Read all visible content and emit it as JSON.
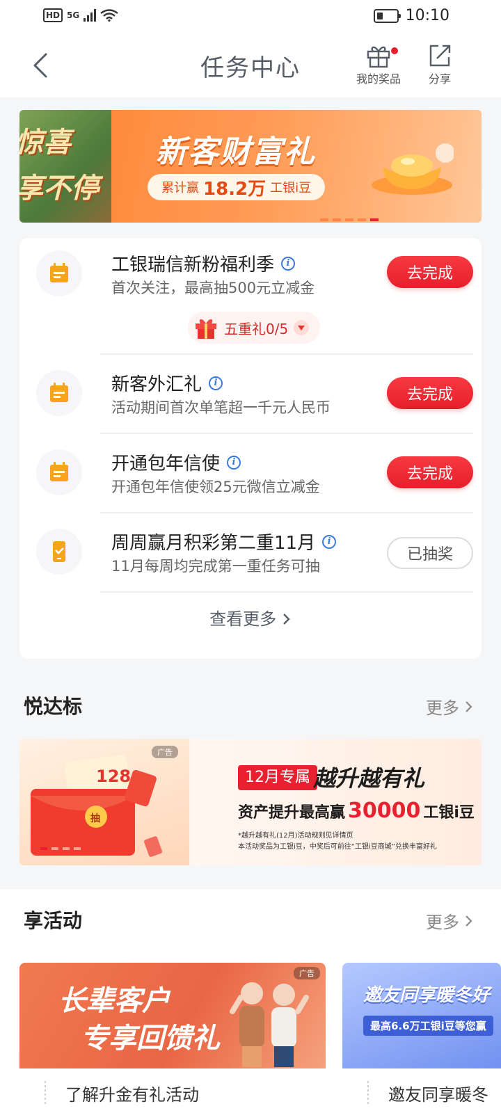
{
  "status_bar": {
    "network_hd": "HD",
    "network_gen": "5G",
    "time": "10:10"
  },
  "header": {
    "title": "任务中心",
    "my_prizes_label": "我的奖品",
    "share_label": "分享"
  },
  "banner": {
    "side_text_line1": "惊喜",
    "side_text_line2": "享不停",
    "title": "新客财富礼",
    "pill_prefix": "累计赢",
    "pill_amount": "18.2万",
    "pill_suffix": "工银i豆"
  },
  "tasks": [
    {
      "title": "工银瑞信新粉福利季",
      "subtitle": "首次关注，最高抽500元立减金",
      "button": "去完成",
      "icon": "calendar-icon"
    },
    {
      "title": "新客外汇礼",
      "subtitle": "活动期间首次单笔超一千元人民币",
      "button": "去完成",
      "icon": "calendar-icon"
    },
    {
      "title": "开通包年信使",
      "subtitle": "开通包年信使领25元微信立减金",
      "button": "去完成",
      "icon": "calendar-icon"
    },
    {
      "title": "周周赢月积彩第二重11月",
      "subtitle": "11月每周均完成第一重任务可抽",
      "button": "已抽奖",
      "icon": "phone-check-icon"
    }
  ],
  "five_gift": {
    "label": "五重礼0/5"
  },
  "view_more": "查看更多",
  "section_yuedabiao": {
    "title": "悦达标",
    "more": "更多"
  },
  "ad": {
    "tag": "广告",
    "left_amount": "128",
    "left_draw": "抽",
    "badge": "12月专属",
    "headline": "越升越有礼",
    "line2_prefix": "资产提升最高赢",
    "line2_amount": "30000",
    "line2_suffix": "工银i豆",
    "note1": "*越升越有礼(12月)活动规则见详情页",
    "note2": "本活动奖品为工银i豆，中奖后可前往“工银i豆商城”兑换丰富好礼"
  },
  "section_activities": {
    "title": "享活动",
    "more": "更多"
  },
  "activities": [
    {
      "headline_line1": "长辈客户",
      "headline_line2": "专享回馈礼",
      "tag": "广告",
      "caption": "了解升金有礼活动"
    },
    {
      "headline_line1": "邀友同享暖冬好",
      "sub": "最高6.6万工银i豆等您赢",
      "caption": "邀友同享暖冬"
    }
  ],
  "colors": {
    "accent_red": "#e61e2b",
    "banner_orange": "#ff8b3d",
    "icon_orange": "#f7a41d"
  }
}
